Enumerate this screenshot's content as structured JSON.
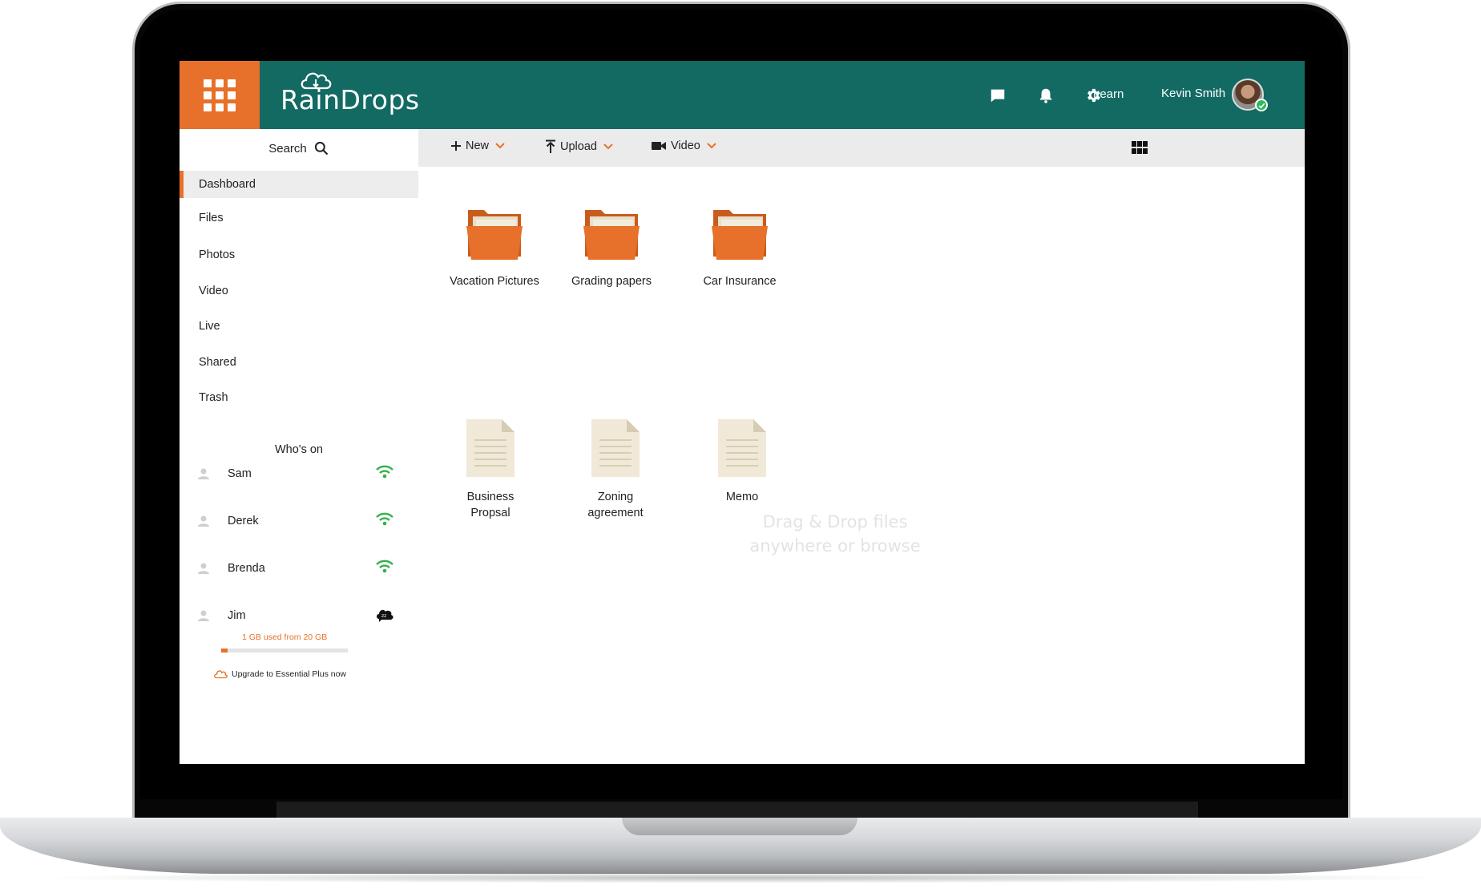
{
  "app": {
    "brand": "RainDrops",
    "accent_color": "#e7712a",
    "header_color": "#126a63"
  },
  "header": {
    "icons": [
      "chat-icon",
      "bell-icon",
      "gear-icon"
    ],
    "learn_label": "Learn",
    "user_name": "Kevin Smith",
    "user_status": "online"
  },
  "sidebar": {
    "search_label": "Search",
    "nav": [
      "Dashboard",
      "Files",
      "Photos",
      "Video",
      "Live",
      "Shared",
      "Trash"
    ],
    "active_nav": "Dashboard",
    "whos_on_title": "Who's on",
    "people": [
      {
        "name": "Sam",
        "status": "online"
      },
      {
        "name": "Derek",
        "status": "online"
      },
      {
        "name": "Brenda",
        "status": "online"
      },
      {
        "name": "Jim",
        "status": "away"
      }
    ],
    "storage_text": "1 GB used from 20 GB",
    "storage_used_fraction": 0.05,
    "upgrade_text": "Upgrade to Essential Plus now"
  },
  "toolbar": {
    "new_label": "New",
    "upload_label": "Upload",
    "video_label": "Video"
  },
  "content": {
    "folders": [
      "Vacation Pictures",
      "Grading papers",
      "Car Insurance"
    ],
    "documents": [
      {
        "line1": "Business",
        "line2": "Propsal"
      },
      {
        "line1": "Zoning",
        "line2": "agreement"
      },
      {
        "line1": "Memo",
        "line2": ""
      }
    ],
    "drop_hint_line1": "Drag & Drop files",
    "drop_hint_line2": "anywhere or browse"
  }
}
